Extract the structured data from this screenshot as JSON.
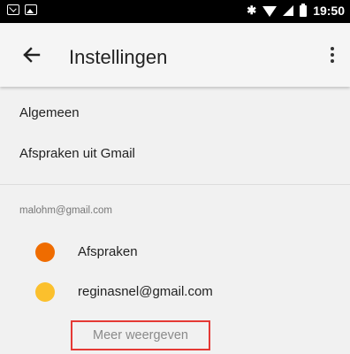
{
  "statusbar": {
    "time": "19:50",
    "icons": [
      "mail-icon",
      "image-icon",
      "bluetooth-icon",
      "wifi-icon",
      "signal-icon",
      "battery-icon"
    ]
  },
  "appbar": {
    "title": "Instellingen",
    "back_icon": "arrow-back-icon",
    "menu_icon": "more-vertical-icon"
  },
  "settings": {
    "items": [
      {
        "label": "Algemeen"
      },
      {
        "label": "Afspraken uit Gmail"
      }
    ]
  },
  "account": {
    "email": "malohm@gmail.com",
    "calendars": [
      {
        "label": "Afspraken",
        "color": "#ef6c00"
      },
      {
        "label": "reginasnel@gmail.com",
        "color": "#fbc02d"
      }
    ],
    "more_label": "Meer weergeven"
  },
  "highlight_color": "#e53935"
}
